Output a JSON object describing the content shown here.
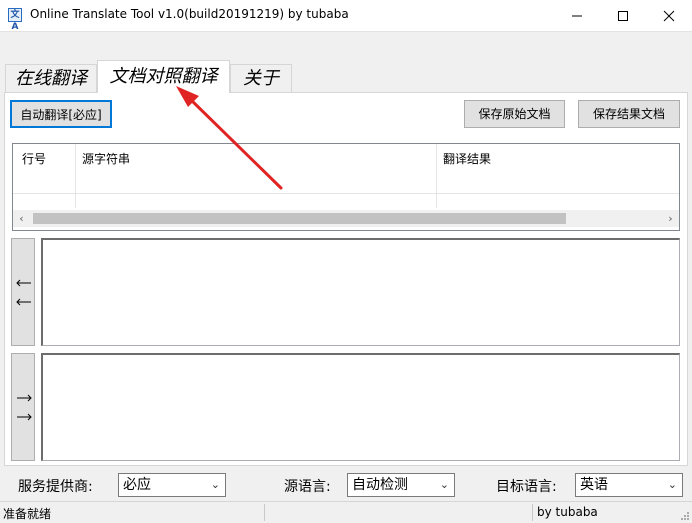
{
  "window": {
    "title": "Online Translate Tool v1.0(build20191219) by tubaba",
    "icon": "translate-app-icon",
    "icon_glyph": "文A"
  },
  "tabs": [
    {
      "label": "在线翻译",
      "selected": false
    },
    {
      "label": "文档对照翻译",
      "selected": true
    },
    {
      "label": "关于",
      "selected": false
    }
  ],
  "toolbar": {
    "auto_translate_label": "自动翻译[必应]",
    "save_source_label": "保存原始文档",
    "save_result_label": "保存结果文档"
  },
  "grid": {
    "columns": [
      "行号",
      "源字符串",
      "翻译结果"
    ],
    "rows": []
  },
  "side_buttons": {
    "to_source_icon": "double-left-arrow-icon",
    "to_target_icon": "double-right-arrow-icon"
  },
  "bottom": {
    "provider_label": "服务提供商:",
    "provider_value": "必应",
    "source_lang_label": "源语言:",
    "source_lang_value": "自动检测",
    "target_lang_label": "目标语言:",
    "target_lang_value": "英语"
  },
  "status": {
    "left_text": "准备就绪",
    "right_text": "by tubaba"
  },
  "colors": {
    "annotation_arrow": "#e02424",
    "focus_border": "#0078d7"
  }
}
